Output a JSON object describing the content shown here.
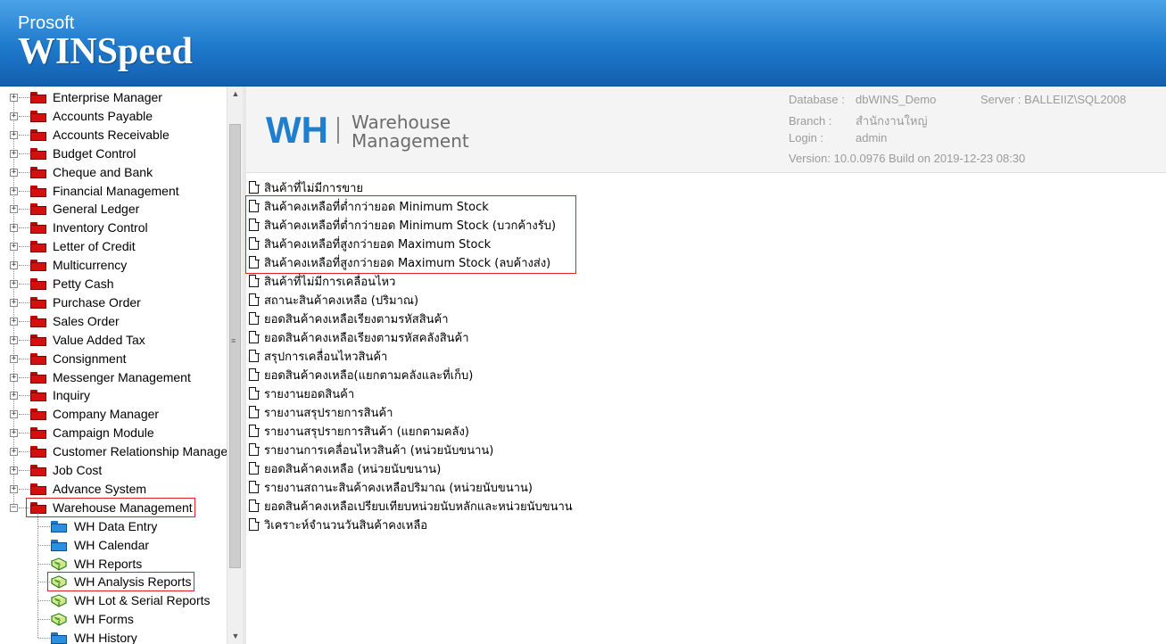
{
  "banner": {
    "brand_small": "Prosoft",
    "brand_big": "WINSpeed"
  },
  "tree": {
    "modules": [
      "Enterprise Manager",
      "Accounts Payable",
      "Accounts Receivable",
      "Budget Control",
      "Cheque and Bank",
      "Financial Management",
      "General Ledger",
      "Inventory Control",
      "Letter of Credit",
      "Multicurrency",
      "Petty Cash",
      "Purchase Order",
      "Sales Order",
      "Value Added Tax",
      "Consignment",
      "Messenger Management",
      "Inquiry",
      "Company Manager",
      "Campaign Module",
      "Customer Relationship Management",
      "Job Cost",
      "Advance System",
      "Warehouse Management"
    ],
    "warehouse_children": [
      {
        "label": "WH Data Entry",
        "icon": "blue-folder-icon"
      },
      {
        "label": "WH Calendar",
        "icon": "blue-folder-icon"
      },
      {
        "label": "WH Reports",
        "icon": "report-book-icon"
      },
      {
        "label": "WH Analysis Reports",
        "icon": "report-book-icon"
      },
      {
        "label": "WH Lot & Serial Reports",
        "icon": "report-book-icon"
      },
      {
        "label": "WH Forms",
        "icon": "report-book-icon"
      },
      {
        "label": "WH History",
        "icon": "blue-folder-icon"
      }
    ],
    "expand_glyph": "+",
    "collapse_glyph": "−"
  },
  "header": {
    "logo_abbr": "WH",
    "logo_line1": "Warehouse",
    "logo_line2": "Management",
    "database_label": "Database :",
    "database_value": "dbWINS_Demo",
    "server_label": "Server :",
    "server_value": "BALLEIIZ\\SQL2008",
    "branch_label": "Branch :",
    "branch_value": "สำนักงานใหญ่",
    "login_label": "Login :",
    "login_value": "admin",
    "version_text": "Version: 10.0.0976  Build on 2019-12-23 08:30"
  },
  "reports": [
    "สินค้าที่ไม่มีการขาย",
    "สินค้าคงเหลือที่ต่ำกว่ายอด Minimum Stock",
    "สินค้าคงเหลือที่ต่ำกว่ายอด Minimum Stock (บวกค้างรับ)",
    "สินค้าคงเหลือที่สูงกว่ายอด Maximum Stock",
    "สินค้าคงเหลือที่สูงกว่ายอด Maximum Stock (ลบค้างส่ง)",
    "สินค้าที่ไม่มีการเคลื่อนไหว",
    "สถานะสินค้าคงเหลือ (ปริมาณ)",
    "ยอดสินค้าคงเหลือเรียงตามรหัสสินค้า",
    "ยอดสินค้าคงเหลือเรียงตามรหัสคลังสินค้า",
    "สรุปการเคลื่อนไหวสินค้า",
    "ยอดสินค้าคงเหลือ(แยกตามคลังและที่เก็บ)",
    "รายงานยอดสินค้า",
    "รายงานสรุปรายการสินค้า",
    "รายงานสรุปรายการสินค้า (แยกตามคลัง)",
    "รายงานการเคลื่อนไหวสินค้า (หน่วยนับขนาน)",
    "ยอดสินค้าคงเหลือ (หน่วยนับขนาน)",
    "รายงานสถานะสินค้าคงเหลือปริมาณ (หน่วยนับขนาน)",
    "ยอดสินค้าคงเหลือเปรียบเทียบหน่วยนับหลักและหน่วยนับขนาน",
    "วิเคราะห์จำนวนวันสินค้าคงเหลือ"
  ],
  "scrollbar": {
    "up_glyph": "▲",
    "down_glyph": "▼",
    "grip_glyph": "≡"
  },
  "colors": {
    "banner": "#1f79cc",
    "highlight": "#e02020",
    "folder_red": "#d40f0f",
    "folder_blue": "#2b8fe0",
    "logo_blue": "#1e7fcf"
  }
}
